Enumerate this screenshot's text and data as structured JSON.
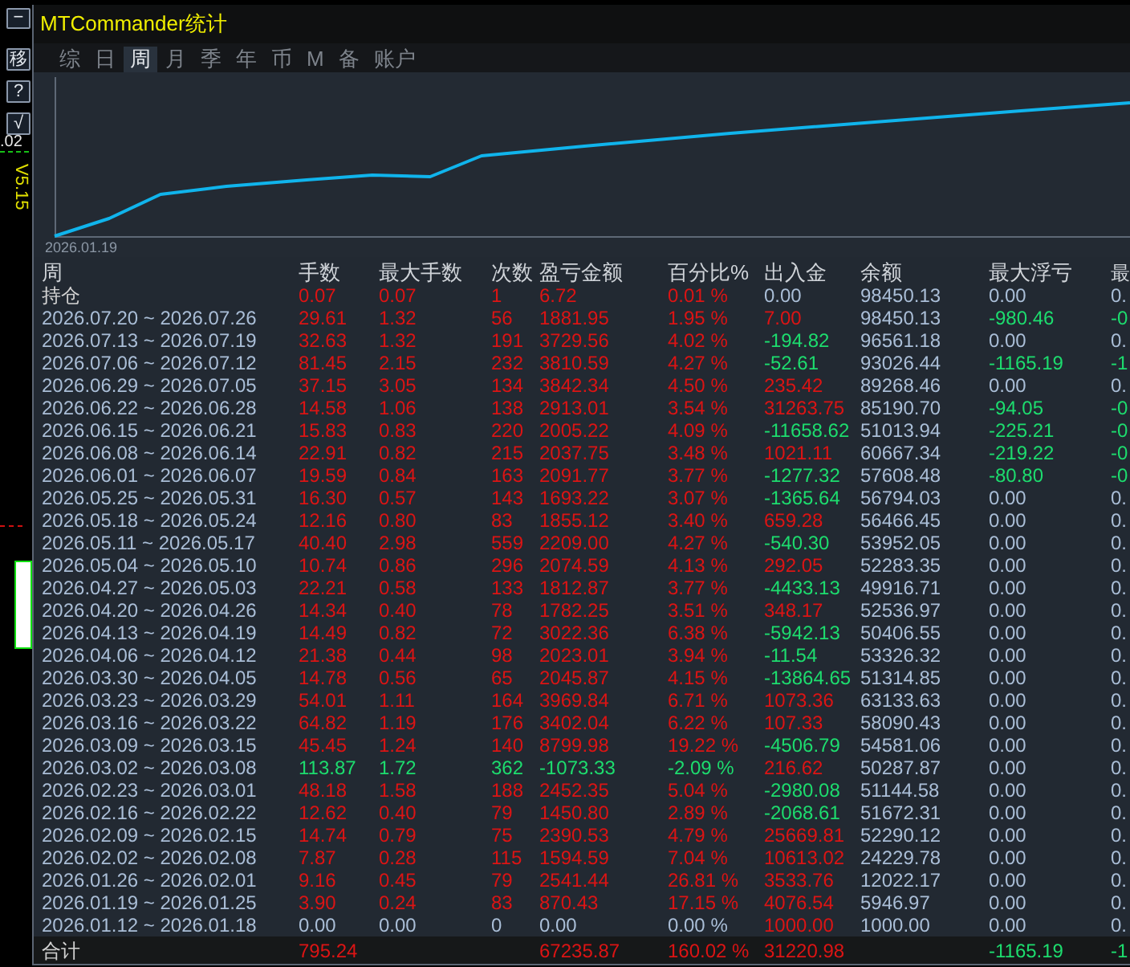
{
  "side_toolbar": {
    "buttons": [
      {
        "label": "−"
      },
      {
        "label": "移"
      },
      {
        "label": "?"
      },
      {
        "label": "√"
      }
    ],
    "price_text": ".02",
    "version": "V5.15"
  },
  "window": {
    "title": "MTCommander统计"
  },
  "tabs": [
    {
      "label": "综",
      "selected": false
    },
    {
      "label": "日",
      "selected": false
    },
    {
      "label": "周",
      "selected": true
    },
    {
      "label": "月",
      "selected": false
    },
    {
      "label": "季",
      "selected": false
    },
    {
      "label": "年",
      "selected": false
    },
    {
      "label": "币",
      "selected": false
    },
    {
      "label": "M",
      "selected": false
    },
    {
      "label": "备",
      "selected": false
    },
    {
      "label": "账户",
      "selected": false
    }
  ],
  "chart": {
    "start_label": "2026.01.19"
  },
  "table": {
    "columns": [
      "周",
      "手数",
      "最大手数",
      "次数",
      "盈亏金额",
      "百分比%",
      "出入金",
      "余额",
      "最大浮亏",
      "最"
    ],
    "rows": [
      {
        "cells": [
          {
            "text": "持仓",
            "color": "#d2d2d2"
          },
          {
            "text": "0.07",
            "color": "#dc1414"
          },
          {
            "text": "0.07",
            "color": "#dc1414"
          },
          {
            "text": "1",
            "color": "#dc1414"
          },
          {
            "text": "6.72",
            "color": "#dc1414"
          },
          {
            "text": "0.01 %",
            "color": "#dc1414"
          },
          {
            "text": "0.00",
            "color": "#aabed7"
          },
          {
            "text": "98450.13",
            "color": "#aabed7"
          },
          {
            "text": "0.00",
            "color": "#aabed7"
          },
          {
            "text": "0.",
            "color": "#aabed7"
          }
        ]
      },
      {
        "cells": [
          {
            "text": "2026.07.20 ~ 2026.07.26",
            "color": "#aabed7"
          },
          {
            "text": "29.61",
            "color": "#dc1414"
          },
          {
            "text": "1.32",
            "color": "#dc1414"
          },
          {
            "text": "56",
            "color": "#dc1414"
          },
          {
            "text": "1881.95",
            "color": "#dc1414"
          },
          {
            "text": "1.95 %",
            "color": "#dc1414"
          },
          {
            "text": "7.00",
            "color": "#dc1414"
          },
          {
            "text": "98450.13",
            "color": "#aabed7"
          },
          {
            "text": "-980.46",
            "color": "#1ddc6e"
          },
          {
            "text": "-0",
            "color": "#1ddc6e"
          }
        ]
      },
      {
        "cells": [
          {
            "text": "2026.07.13 ~ 2026.07.19",
            "color": "#aabed7"
          },
          {
            "text": "32.63",
            "color": "#dc1414"
          },
          {
            "text": "1.32",
            "color": "#dc1414"
          },
          {
            "text": "191",
            "color": "#dc1414"
          },
          {
            "text": "3729.56",
            "color": "#dc1414"
          },
          {
            "text": "4.02 %",
            "color": "#dc1414"
          },
          {
            "text": "-194.82",
            "color": "#1ddc6e"
          },
          {
            "text": "96561.18",
            "color": "#aabed7"
          },
          {
            "text": "0.00",
            "color": "#aabed7"
          },
          {
            "text": "0.",
            "color": "#aabed7"
          }
        ]
      },
      {
        "cells": [
          {
            "text": "2026.07.06 ~ 2026.07.12",
            "color": "#aabed7"
          },
          {
            "text": "81.45",
            "color": "#dc1414"
          },
          {
            "text": "2.15",
            "color": "#dc1414"
          },
          {
            "text": "232",
            "color": "#dc1414"
          },
          {
            "text": "3810.59",
            "color": "#dc1414"
          },
          {
            "text": "4.27 %",
            "color": "#dc1414"
          },
          {
            "text": "-52.61",
            "color": "#1ddc6e"
          },
          {
            "text": "93026.44",
            "color": "#aabed7"
          },
          {
            "text": "-1165.19",
            "color": "#1ddc6e"
          },
          {
            "text": "-1",
            "color": "#1ddc6e"
          }
        ]
      },
      {
        "cells": [
          {
            "text": "2026.06.29 ~ 2026.07.05",
            "color": "#aabed7"
          },
          {
            "text": "37.15",
            "color": "#dc1414"
          },
          {
            "text": "3.05",
            "color": "#dc1414"
          },
          {
            "text": "134",
            "color": "#dc1414"
          },
          {
            "text": "3842.34",
            "color": "#dc1414"
          },
          {
            "text": "4.50 %",
            "color": "#dc1414"
          },
          {
            "text": "235.42",
            "color": "#dc1414"
          },
          {
            "text": "89268.46",
            "color": "#aabed7"
          },
          {
            "text": "0.00",
            "color": "#aabed7"
          },
          {
            "text": "0.",
            "color": "#aabed7"
          }
        ]
      },
      {
        "cells": [
          {
            "text": "2026.06.22 ~ 2026.06.28",
            "color": "#aabed7"
          },
          {
            "text": "14.58",
            "color": "#dc1414"
          },
          {
            "text": "1.06",
            "color": "#dc1414"
          },
          {
            "text": "138",
            "color": "#dc1414"
          },
          {
            "text": "2913.01",
            "color": "#dc1414"
          },
          {
            "text": "3.54 %",
            "color": "#dc1414"
          },
          {
            "text": "31263.75",
            "color": "#dc1414"
          },
          {
            "text": "85190.70",
            "color": "#aabed7"
          },
          {
            "text": "-94.05",
            "color": "#1ddc6e"
          },
          {
            "text": "-0",
            "color": "#1ddc6e"
          }
        ]
      },
      {
        "cells": [
          {
            "text": "2026.06.15 ~ 2026.06.21",
            "color": "#aabed7"
          },
          {
            "text": "15.83",
            "color": "#dc1414"
          },
          {
            "text": "0.83",
            "color": "#dc1414"
          },
          {
            "text": "220",
            "color": "#dc1414"
          },
          {
            "text": "2005.22",
            "color": "#dc1414"
          },
          {
            "text": "4.09 %",
            "color": "#dc1414"
          },
          {
            "text": "-11658.62",
            "color": "#1ddc6e"
          },
          {
            "text": "51013.94",
            "color": "#aabed7"
          },
          {
            "text": "-225.21",
            "color": "#1ddc6e"
          },
          {
            "text": "-0",
            "color": "#1ddc6e"
          }
        ]
      },
      {
        "cells": [
          {
            "text": "2026.06.08 ~ 2026.06.14",
            "color": "#aabed7"
          },
          {
            "text": "22.91",
            "color": "#dc1414"
          },
          {
            "text": "0.82",
            "color": "#dc1414"
          },
          {
            "text": "215",
            "color": "#dc1414"
          },
          {
            "text": "2037.75",
            "color": "#dc1414"
          },
          {
            "text": "3.48 %",
            "color": "#dc1414"
          },
          {
            "text": "1021.11",
            "color": "#dc1414"
          },
          {
            "text": "60667.34",
            "color": "#aabed7"
          },
          {
            "text": "-219.22",
            "color": "#1ddc6e"
          },
          {
            "text": "-0",
            "color": "#1ddc6e"
          }
        ]
      },
      {
        "cells": [
          {
            "text": "2026.06.01 ~ 2026.06.07",
            "color": "#aabed7"
          },
          {
            "text": "19.59",
            "color": "#dc1414"
          },
          {
            "text": "0.84",
            "color": "#dc1414"
          },
          {
            "text": "163",
            "color": "#dc1414"
          },
          {
            "text": "2091.77",
            "color": "#dc1414"
          },
          {
            "text": "3.77 %",
            "color": "#dc1414"
          },
          {
            "text": "-1277.32",
            "color": "#1ddc6e"
          },
          {
            "text": "57608.48",
            "color": "#aabed7"
          },
          {
            "text": "-80.80",
            "color": "#1ddc6e"
          },
          {
            "text": "-0",
            "color": "#1ddc6e"
          }
        ]
      },
      {
        "cells": [
          {
            "text": "2026.05.25 ~ 2026.05.31",
            "color": "#aabed7"
          },
          {
            "text": "16.30",
            "color": "#dc1414"
          },
          {
            "text": "0.57",
            "color": "#dc1414"
          },
          {
            "text": "143",
            "color": "#dc1414"
          },
          {
            "text": "1693.22",
            "color": "#dc1414"
          },
          {
            "text": "3.07 %",
            "color": "#dc1414"
          },
          {
            "text": "-1365.64",
            "color": "#1ddc6e"
          },
          {
            "text": "56794.03",
            "color": "#aabed7"
          },
          {
            "text": "0.00",
            "color": "#aabed7"
          },
          {
            "text": "0.",
            "color": "#aabed7"
          }
        ]
      },
      {
        "cells": [
          {
            "text": "2026.05.18 ~ 2026.05.24",
            "color": "#aabed7"
          },
          {
            "text": "12.16",
            "color": "#dc1414"
          },
          {
            "text": "0.80",
            "color": "#dc1414"
          },
          {
            "text": "83",
            "color": "#dc1414"
          },
          {
            "text": "1855.12",
            "color": "#dc1414"
          },
          {
            "text": "3.40 %",
            "color": "#dc1414"
          },
          {
            "text": "659.28",
            "color": "#dc1414"
          },
          {
            "text": "56466.45",
            "color": "#aabed7"
          },
          {
            "text": "0.00",
            "color": "#aabed7"
          },
          {
            "text": "0.",
            "color": "#aabed7"
          }
        ]
      },
      {
        "cells": [
          {
            "text": "2026.05.11 ~ 2026.05.17",
            "color": "#aabed7"
          },
          {
            "text": "40.40",
            "color": "#dc1414"
          },
          {
            "text": "2.98",
            "color": "#dc1414"
          },
          {
            "text": "559",
            "color": "#dc1414"
          },
          {
            "text": "2209.00",
            "color": "#dc1414"
          },
          {
            "text": "4.27 %",
            "color": "#dc1414"
          },
          {
            "text": "-540.30",
            "color": "#1ddc6e"
          },
          {
            "text": "53952.05",
            "color": "#aabed7"
          },
          {
            "text": "0.00",
            "color": "#aabed7"
          },
          {
            "text": "0.",
            "color": "#aabed7"
          }
        ]
      },
      {
        "cells": [
          {
            "text": "2026.05.04 ~ 2026.05.10",
            "color": "#aabed7"
          },
          {
            "text": "10.74",
            "color": "#dc1414"
          },
          {
            "text": "0.86",
            "color": "#dc1414"
          },
          {
            "text": "296",
            "color": "#dc1414"
          },
          {
            "text": "2074.59",
            "color": "#dc1414"
          },
          {
            "text": "4.13 %",
            "color": "#dc1414"
          },
          {
            "text": "292.05",
            "color": "#dc1414"
          },
          {
            "text": "52283.35",
            "color": "#aabed7"
          },
          {
            "text": "0.00",
            "color": "#aabed7"
          },
          {
            "text": "0.",
            "color": "#aabed7"
          }
        ]
      },
      {
        "cells": [
          {
            "text": "2026.04.27 ~ 2026.05.03",
            "color": "#aabed7"
          },
          {
            "text": "22.21",
            "color": "#dc1414"
          },
          {
            "text": "0.58",
            "color": "#dc1414"
          },
          {
            "text": "133",
            "color": "#dc1414"
          },
          {
            "text": "1812.87",
            "color": "#dc1414"
          },
          {
            "text": "3.77 %",
            "color": "#dc1414"
          },
          {
            "text": "-4433.13",
            "color": "#1ddc6e"
          },
          {
            "text": "49916.71",
            "color": "#aabed7"
          },
          {
            "text": "0.00",
            "color": "#aabed7"
          },
          {
            "text": "0.",
            "color": "#aabed7"
          }
        ]
      },
      {
        "cells": [
          {
            "text": "2026.04.20 ~ 2026.04.26",
            "color": "#aabed7"
          },
          {
            "text": "14.34",
            "color": "#dc1414"
          },
          {
            "text": "0.40",
            "color": "#dc1414"
          },
          {
            "text": "78",
            "color": "#dc1414"
          },
          {
            "text": "1782.25",
            "color": "#dc1414"
          },
          {
            "text": "3.51 %",
            "color": "#dc1414"
          },
          {
            "text": "348.17",
            "color": "#dc1414"
          },
          {
            "text": "52536.97",
            "color": "#aabed7"
          },
          {
            "text": "0.00",
            "color": "#aabed7"
          },
          {
            "text": "0.",
            "color": "#aabed7"
          }
        ]
      },
      {
        "cells": [
          {
            "text": "2026.04.13 ~ 2026.04.19",
            "color": "#aabed7"
          },
          {
            "text": "14.49",
            "color": "#dc1414"
          },
          {
            "text": "0.82",
            "color": "#dc1414"
          },
          {
            "text": "72",
            "color": "#dc1414"
          },
          {
            "text": "3022.36",
            "color": "#dc1414"
          },
          {
            "text": "6.38 %",
            "color": "#dc1414"
          },
          {
            "text": "-5942.13",
            "color": "#1ddc6e"
          },
          {
            "text": "50406.55",
            "color": "#aabed7"
          },
          {
            "text": "0.00",
            "color": "#aabed7"
          },
          {
            "text": "0.",
            "color": "#aabed7"
          }
        ]
      },
      {
        "cells": [
          {
            "text": "2026.04.06 ~ 2026.04.12",
            "color": "#aabed7"
          },
          {
            "text": "21.38",
            "color": "#dc1414"
          },
          {
            "text": "0.44",
            "color": "#dc1414"
          },
          {
            "text": "98",
            "color": "#dc1414"
          },
          {
            "text": "2023.01",
            "color": "#dc1414"
          },
          {
            "text": "3.94 %",
            "color": "#dc1414"
          },
          {
            "text": "-11.54",
            "color": "#1ddc6e"
          },
          {
            "text": "53326.32",
            "color": "#aabed7"
          },
          {
            "text": "0.00",
            "color": "#aabed7"
          },
          {
            "text": "0.",
            "color": "#aabed7"
          }
        ]
      },
      {
        "cells": [
          {
            "text": "2026.03.30 ~ 2026.04.05",
            "color": "#aabed7"
          },
          {
            "text": "14.78",
            "color": "#dc1414"
          },
          {
            "text": "0.56",
            "color": "#dc1414"
          },
          {
            "text": "65",
            "color": "#dc1414"
          },
          {
            "text": "2045.87",
            "color": "#dc1414"
          },
          {
            "text": "4.15 %",
            "color": "#dc1414"
          },
          {
            "text": "-13864.65",
            "color": "#1ddc6e"
          },
          {
            "text": "51314.85",
            "color": "#aabed7"
          },
          {
            "text": "0.00",
            "color": "#aabed7"
          },
          {
            "text": "0.",
            "color": "#aabed7"
          }
        ]
      },
      {
        "cells": [
          {
            "text": "2026.03.23 ~ 2026.03.29",
            "color": "#aabed7"
          },
          {
            "text": "54.01",
            "color": "#dc1414"
          },
          {
            "text": "1.11",
            "color": "#dc1414"
          },
          {
            "text": "164",
            "color": "#dc1414"
          },
          {
            "text": "3969.84",
            "color": "#dc1414"
          },
          {
            "text": "6.71 %",
            "color": "#dc1414"
          },
          {
            "text": "1073.36",
            "color": "#dc1414"
          },
          {
            "text": "63133.63",
            "color": "#aabed7"
          },
          {
            "text": "0.00",
            "color": "#aabed7"
          },
          {
            "text": "0.",
            "color": "#aabed7"
          }
        ]
      },
      {
        "cells": [
          {
            "text": "2026.03.16 ~ 2026.03.22",
            "color": "#aabed7"
          },
          {
            "text": "64.82",
            "color": "#dc1414"
          },
          {
            "text": "1.19",
            "color": "#dc1414"
          },
          {
            "text": "176",
            "color": "#dc1414"
          },
          {
            "text": "3402.04",
            "color": "#dc1414"
          },
          {
            "text": "6.22 %",
            "color": "#dc1414"
          },
          {
            "text": "107.33",
            "color": "#dc1414"
          },
          {
            "text": "58090.43",
            "color": "#aabed7"
          },
          {
            "text": "0.00",
            "color": "#aabed7"
          },
          {
            "text": "0.",
            "color": "#aabed7"
          }
        ]
      },
      {
        "cells": [
          {
            "text": "2026.03.09 ~ 2026.03.15",
            "color": "#aabed7"
          },
          {
            "text": "45.45",
            "color": "#dc1414"
          },
          {
            "text": "1.24",
            "color": "#dc1414"
          },
          {
            "text": "140",
            "color": "#dc1414"
          },
          {
            "text": "8799.98",
            "color": "#dc1414"
          },
          {
            "text": "19.22 %",
            "color": "#dc1414"
          },
          {
            "text": "-4506.79",
            "color": "#1ddc6e"
          },
          {
            "text": "54581.06",
            "color": "#aabed7"
          },
          {
            "text": "0.00",
            "color": "#aabed7"
          },
          {
            "text": "0.",
            "color": "#aabed7"
          }
        ]
      },
      {
        "cells": [
          {
            "text": "2026.03.02 ~ 2026.03.08",
            "color": "#aabed7"
          },
          {
            "text": "113.87",
            "color": "#1ddc6e"
          },
          {
            "text": "1.72",
            "color": "#1ddc6e"
          },
          {
            "text": "362",
            "color": "#1ddc6e"
          },
          {
            "text": "-1073.33",
            "color": "#1ddc6e"
          },
          {
            "text": "-2.09 %",
            "color": "#1ddc6e"
          },
          {
            "text": "216.62",
            "color": "#dc1414"
          },
          {
            "text": "50287.87",
            "color": "#aabed7"
          },
          {
            "text": "0.00",
            "color": "#aabed7"
          },
          {
            "text": "0.",
            "color": "#aabed7"
          }
        ]
      },
      {
        "cells": [
          {
            "text": "2026.02.23 ~ 2026.03.01",
            "color": "#aabed7"
          },
          {
            "text": "48.18",
            "color": "#dc1414"
          },
          {
            "text": "1.58",
            "color": "#dc1414"
          },
          {
            "text": "188",
            "color": "#dc1414"
          },
          {
            "text": "2452.35",
            "color": "#dc1414"
          },
          {
            "text": "5.04 %",
            "color": "#dc1414"
          },
          {
            "text": "-2980.08",
            "color": "#1ddc6e"
          },
          {
            "text": "51144.58",
            "color": "#aabed7"
          },
          {
            "text": "0.00",
            "color": "#aabed7"
          },
          {
            "text": "0.",
            "color": "#aabed7"
          }
        ]
      },
      {
        "cells": [
          {
            "text": "2026.02.16 ~ 2026.02.22",
            "color": "#aabed7"
          },
          {
            "text": "12.62",
            "color": "#dc1414"
          },
          {
            "text": "0.40",
            "color": "#dc1414"
          },
          {
            "text": "79",
            "color": "#dc1414"
          },
          {
            "text": "1450.80",
            "color": "#dc1414"
          },
          {
            "text": "2.89 %",
            "color": "#dc1414"
          },
          {
            "text": "-2068.61",
            "color": "#1ddc6e"
          },
          {
            "text": "51672.31",
            "color": "#aabed7"
          },
          {
            "text": "0.00",
            "color": "#aabed7"
          },
          {
            "text": "0.",
            "color": "#aabed7"
          }
        ]
      },
      {
        "cells": [
          {
            "text": "2026.02.09 ~ 2026.02.15",
            "color": "#aabed7"
          },
          {
            "text": "14.74",
            "color": "#dc1414"
          },
          {
            "text": "0.79",
            "color": "#dc1414"
          },
          {
            "text": "75",
            "color": "#dc1414"
          },
          {
            "text": "2390.53",
            "color": "#dc1414"
          },
          {
            "text": "4.79 %",
            "color": "#dc1414"
          },
          {
            "text": "25669.81",
            "color": "#dc1414"
          },
          {
            "text": "52290.12",
            "color": "#aabed7"
          },
          {
            "text": "0.00",
            "color": "#aabed7"
          },
          {
            "text": "0.",
            "color": "#aabed7"
          }
        ]
      },
      {
        "cells": [
          {
            "text": "2026.02.02 ~ 2026.02.08",
            "color": "#aabed7"
          },
          {
            "text": "7.87",
            "color": "#dc1414"
          },
          {
            "text": "0.28",
            "color": "#dc1414"
          },
          {
            "text": "115",
            "color": "#dc1414"
          },
          {
            "text": "1594.59",
            "color": "#dc1414"
          },
          {
            "text": "7.04 %",
            "color": "#dc1414"
          },
          {
            "text": "10613.02",
            "color": "#dc1414"
          },
          {
            "text": "24229.78",
            "color": "#aabed7"
          },
          {
            "text": "0.00",
            "color": "#aabed7"
          },
          {
            "text": "0.",
            "color": "#aabed7"
          }
        ]
      },
      {
        "cells": [
          {
            "text": "2026.01.26 ~ 2026.02.01",
            "color": "#aabed7"
          },
          {
            "text": "9.16",
            "color": "#dc1414"
          },
          {
            "text": "0.45",
            "color": "#dc1414"
          },
          {
            "text": "79",
            "color": "#dc1414"
          },
          {
            "text": "2541.44",
            "color": "#dc1414"
          },
          {
            "text": "26.81 %",
            "color": "#dc1414"
          },
          {
            "text": "3533.76",
            "color": "#dc1414"
          },
          {
            "text": "12022.17",
            "color": "#aabed7"
          },
          {
            "text": "0.00",
            "color": "#aabed7"
          },
          {
            "text": "0.",
            "color": "#aabed7"
          }
        ]
      },
      {
        "cells": [
          {
            "text": "2026.01.19 ~ 2026.01.25",
            "color": "#aabed7"
          },
          {
            "text": "3.90",
            "color": "#dc1414"
          },
          {
            "text": "0.24",
            "color": "#dc1414"
          },
          {
            "text": "83",
            "color": "#dc1414"
          },
          {
            "text": "870.43",
            "color": "#dc1414"
          },
          {
            "text": "17.15 %",
            "color": "#dc1414"
          },
          {
            "text": "4076.54",
            "color": "#dc1414"
          },
          {
            "text": "5946.97",
            "color": "#aabed7"
          },
          {
            "text": "0.00",
            "color": "#aabed7"
          },
          {
            "text": "0.",
            "color": "#aabed7"
          }
        ]
      },
      {
        "cells": [
          {
            "text": "2026.01.12 ~ 2026.01.18",
            "color": "#aabed7"
          },
          {
            "text": "0.00",
            "color": "#aabed7"
          },
          {
            "text": "0.00",
            "color": "#aabed7"
          },
          {
            "text": "0",
            "color": "#aabed7"
          },
          {
            "text": "0.00",
            "color": "#aabed7"
          },
          {
            "text": "0.00 %",
            "color": "#aabed7"
          },
          {
            "text": "1000.00",
            "color": "#dc1414"
          },
          {
            "text": "1000.00",
            "color": "#aabed7"
          },
          {
            "text": "0.00",
            "color": "#aabed7"
          },
          {
            "text": "0.",
            "color": "#aabed7"
          }
        ]
      }
    ],
    "total": {
      "cells": [
        {
          "text": "合计",
          "color": "#d2d2d2"
        },
        {
          "text": "795.24",
          "color": "#dc1414"
        },
        null,
        null,
        {
          "text": "67235.87",
          "color": "#dc1414"
        },
        {
          "text": "160.02 %",
          "color": "#dc1414"
        },
        {
          "text": "31220.98",
          "color": "#dc1414"
        },
        null,
        {
          "text": "-1165.19",
          "color": "#1ddc6e"
        },
        {
          "text": "-1",
          "color": "#1ddc6e"
        }
      ]
    }
  }
}
